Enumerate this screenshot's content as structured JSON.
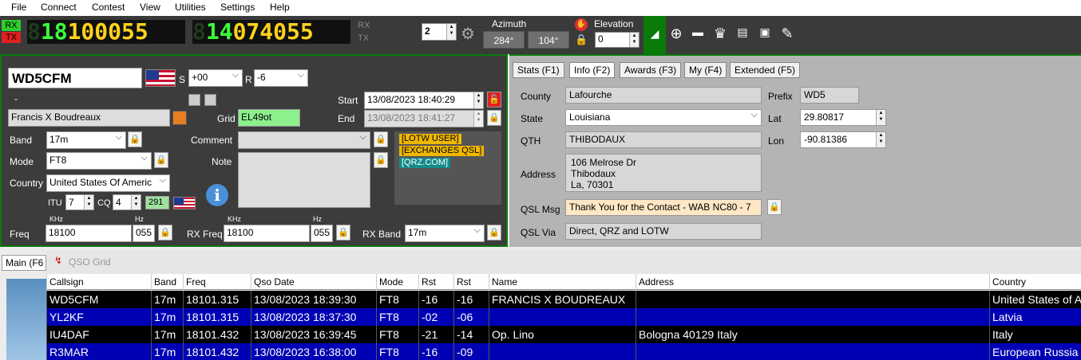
{
  "menu": [
    "File",
    "Connect",
    "Contest",
    "View",
    "Utilities",
    "Settings",
    "Help"
  ],
  "radio": {
    "rx_label": "RX",
    "tx_label": "TX",
    "freq1_dim": "8",
    "freq1": "18100055",
    "freq2_dim": "8",
    "freq2": "14074055",
    "rx_side": "RX",
    "tx_side": "TX",
    "spin_value": "2",
    "azimuth_label": "Azimuth",
    "azimuth1": "284°",
    "azimuth2": "104°",
    "elevation_label": "Elevation",
    "elevation_value": "0"
  },
  "qso": {
    "callsign": "WD5CFM",
    "s_label": "S",
    "s_value": "+00",
    "r_label": "R",
    "r_value": "-6",
    "dash": "-",
    "name": "Francis X Boudreaux",
    "grid_label": "Grid",
    "grid": "EL49ot",
    "start_label": "Start",
    "start": "13/08/2023 18:40:29",
    "end_label": "End",
    "end": "13/08/2023 18:41:27",
    "band_label": "Band",
    "band": "17m",
    "comment_label": "Comment",
    "mode_label": "Mode",
    "mode": "FT8",
    "note_label": "Note",
    "country_label": "Country",
    "country": "United States Of Americ",
    "itu_label": "ITU",
    "itu": "7",
    "cq_label": "CQ",
    "cq": "4",
    "dxcc": "291",
    "khz_label": "KHz",
    "hz_label": "Hz",
    "freq_label": "Freq",
    "freq_khz": "18100",
    "freq_hz": "055",
    "rx_freq_label": "RX Freq",
    "rx_freq_khz": "18100",
    "rx_freq_hz": "055",
    "rx_band_label": "RX Band",
    "rx_band": "17m",
    "tags": [
      "[LOTW USER]",
      "[EXCHANGES QSL]",
      "[QRZ.COM]"
    ]
  },
  "info": {
    "tabs": [
      "Stats (F1)",
      "Info (F2)",
      "Awards (F3)",
      "My (F4)",
      "Extended (F5)"
    ],
    "county_label": "County",
    "county": "Lafourche",
    "prefix_label": "Prefix",
    "prefix": "WD5",
    "state_label": "State",
    "state": "Louisiana",
    "lat_label": "Lat",
    "lat": "29.80817",
    "qth_label": "QTH",
    "qth": "THIBODAUX",
    "lon_label": "Lon",
    "lon": "-90.81386",
    "address_label": "Address",
    "address_lines": [
      "106 Melrose Dr",
      "Thibodaux",
      "La, 70301"
    ],
    "qslmsg_label": "QSL Msg",
    "qslmsg": "Thank You for the Contact - WAB NC80 - 7",
    "qslvia_label": "QSL Via",
    "qslvia": "Direct, QRZ and LOTW"
  },
  "lower": {
    "main_tab": "Main (F6",
    "grid_title": "QSO Grid",
    "columns": [
      "Callsign",
      "Band",
      "Freq",
      "Qso Date",
      "Mode",
      "Rst",
      "Rst",
      "Name",
      "Address",
      "Country"
    ],
    "rows": [
      [
        "WD5CFM",
        "17m",
        "18101.315",
        "13/08/2023 18:39:30",
        "FT8",
        "-16",
        "-16",
        "FRANCIS X BOUDREAUX",
        "",
        "United States of A"
      ],
      [
        "YL2KF",
        "17m",
        "18101.315",
        "13/08/2023 18:37:30",
        "FT8",
        "-02",
        "-06",
        "",
        "",
        "Latvia"
      ],
      [
        "IU4DAF",
        "17m",
        "18101.432",
        "13/08/2023 16:39:45",
        "FT8",
        "-21",
        "-14",
        "Op. Lino",
        "Bologna 40129 Italy",
        "Italy"
      ],
      [
        "R3MAR",
        "17m",
        "18101.432",
        "13/08/2023 16:38:00",
        "FT8",
        "-16",
        "-09",
        "",
        "",
        "European Russia"
      ]
    ],
    "row_colors": [
      "#000000",
      "#0000b4",
      "#000000",
      "#0000b4"
    ]
  }
}
